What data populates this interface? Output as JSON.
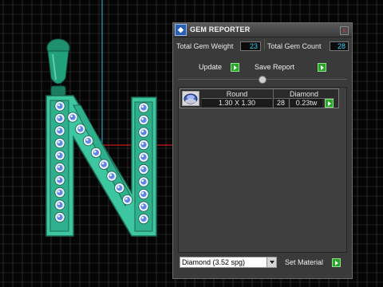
{
  "panel": {
    "title": "GEM REPORTER",
    "title_icon_glyph": "◆",
    "close_glyph": "x",
    "total_gem_weight_label": "Total Gem Weight",
    "total_gem_weight_value": "23",
    "total_gem_count_label": "Total Gem Count",
    "total_gem_count_value": "28",
    "update_label": "Update",
    "save_report_label": "Save Report",
    "gems": [
      {
        "shape": "Round",
        "size": "1.30 X 1.30",
        "material": "Diamond",
        "count": "28",
        "weight": "0.23tw"
      }
    ],
    "material_value": "Diamond   (3.52 spg)",
    "set_material_label": "Set Material"
  },
  "colors": {
    "viewport_bg": "#050505",
    "grid": "#4a4a4a",
    "axis_cyan": "#1aa7b6",
    "axis_red": "#c31a1a",
    "model_green": "#3cc7a0",
    "accent_value": "#2fd5ff",
    "go_button": "#2aa52a"
  }
}
